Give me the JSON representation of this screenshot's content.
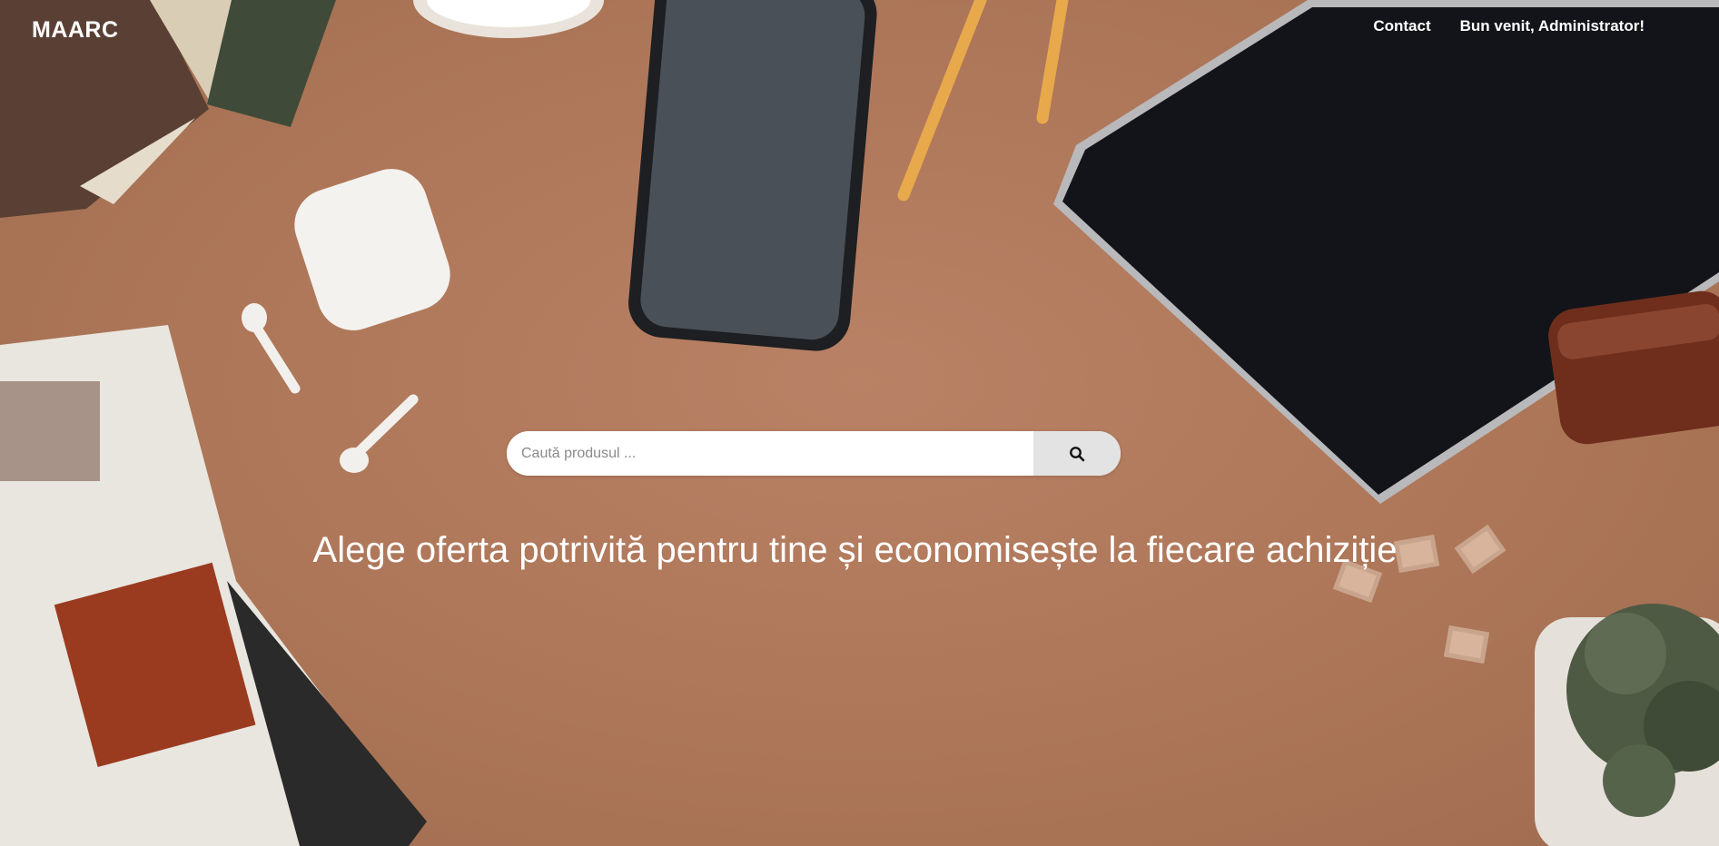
{
  "brand": {
    "logo_text": "MAARC"
  },
  "nav": {
    "items": [
      {
        "label": "Contact"
      },
      {
        "label": "Bun venit, Administrator!"
      }
    ]
  },
  "search": {
    "placeholder": "Caută produsul ...",
    "value": "",
    "button_icon": "search-icon"
  },
  "hero": {
    "tagline": "Alege oferta potrivită pentru tine și economisește la fiecare achiziție",
    "background_image": "desk-flatlay-photo"
  },
  "colors": {
    "background": "#b07a5c",
    "text": "#ffffff",
    "search_button": "#e3e3e3"
  }
}
